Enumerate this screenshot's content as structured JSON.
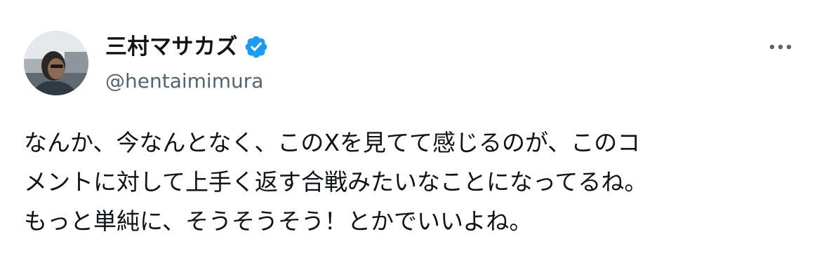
{
  "author": {
    "display_name": "三村マサカズ",
    "handle": "@hentaimimura",
    "verified_icon": "verified-badge-icon",
    "avatar_icon": "avatar-photo"
  },
  "menu": {
    "more_icon": "more-horizontal-icon"
  },
  "tweet": {
    "lines": [
      "なんか、今なんとなく、このXを見てて感じるのが、このコ",
      "メントに対して上手く返す合戦みたいなことになってるね。",
      "もっと単純に、そうそうそう！とかでいいよね。"
    ]
  },
  "colors": {
    "text": "#0f1419",
    "secondary": "#536471",
    "verified": "#1d9bf0",
    "background": "#ffffff"
  }
}
